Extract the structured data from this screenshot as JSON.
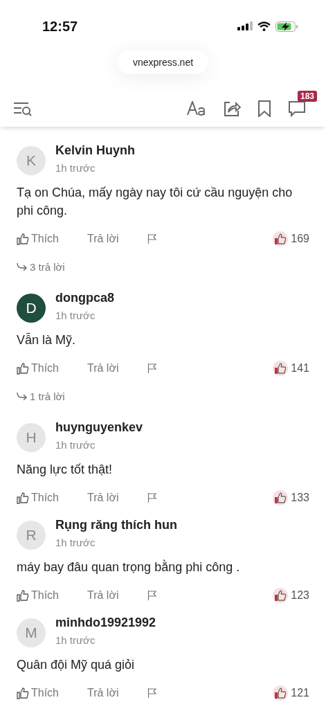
{
  "status_bar": {
    "time": "12:57"
  },
  "url_bar": {
    "url": "vnexpress.net"
  },
  "toolbar": {
    "comment_count": "183"
  },
  "comments": [
    {
      "author": "Kelvin Huynh",
      "avatar_letter": "K",
      "color": "#e6e6e6",
      "time": "1h trước",
      "text": "Tạ on Chúa, mấy ngày nay tôi cứ cầu nguyện cho phi công.",
      "like_label": "Thích",
      "reply_label": "Trả lời",
      "like_count": "169",
      "replies": "3 trả lời"
    },
    {
      "author": "dongpca8",
      "avatar_letter": "D",
      "color": "#1f4d3f",
      "time": "1h trước",
      "text": "Vẫn là Mỹ.",
      "like_label": "Thích",
      "reply_label": "Trả lời",
      "like_count": "141",
      "replies": "1 trả lời"
    },
    {
      "author": "huynguyenkev",
      "avatar_letter": "H",
      "color": "#e6e6e6",
      "time": "1h trước",
      "text": "Năng lực tốt thật!",
      "like_label": "Thích",
      "reply_label": "Trả lời",
      "like_count": "133"
    },
    {
      "author": "Rụng răng thích hun",
      "avatar_letter": "R",
      "color": "#e6e6e6",
      "time": "1h trước",
      "text": " máy bay đâu quan trọng bằng phi công .",
      "like_label": "Thích",
      "reply_label": "Trả lời",
      "like_count": "123"
    },
    {
      "author": "minhdo19921992",
      "avatar_letter": "M",
      "color": "#e6e6e6",
      "time": "1h trước",
      "text": "Quân đội Mỹ quá giỏi",
      "like_label": "Thích",
      "reply_label": "Trả lời",
      "like_count": "121"
    }
  ]
}
